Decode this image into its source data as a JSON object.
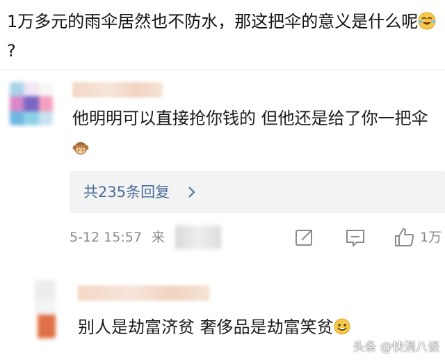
{
  "post": {
    "text": "1万多元的雨伞居然也不防水，那这把伞的意义是什么呢",
    "emoji": "crying-laughing-emoji",
    "suffix": "?"
  },
  "comments": [
    {
      "text": "他明明可以直接抢你钱的 但他还是给了你一把伞",
      "emoji": "monkey-emoji",
      "replies_label": "共235条回复",
      "timestamp": "5-12 15:57",
      "source_prefix": "来",
      "like_count": "1万"
    },
    {
      "text": "别人是劫富济贫 奢侈品是劫富笑贫",
      "emoji": "grinning-emoji"
    }
  ],
  "watermark": "头条 @快消八谈",
  "colors": {
    "link": "#4a6c9b",
    "meta": "#8a8a8a",
    "reply_bg": "#f3f3f3"
  }
}
